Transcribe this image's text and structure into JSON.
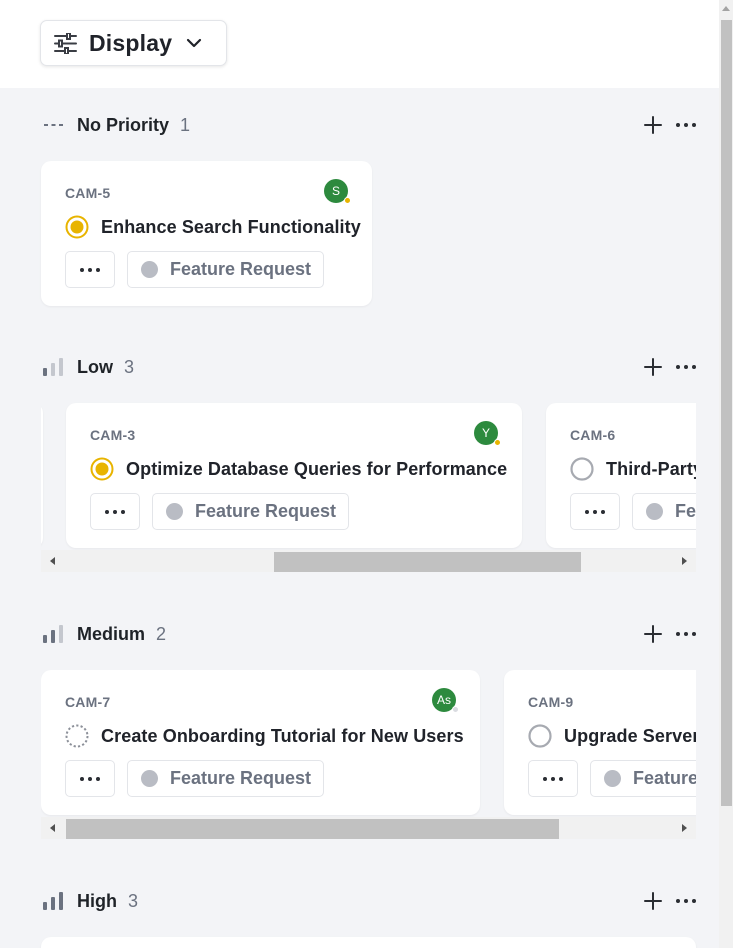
{
  "toolbar": {
    "display_label": "Display"
  },
  "colors": {
    "in_progress": "#e8b400",
    "avatar_bg": "#2d8a3e",
    "label_dot": "#b9bcc4"
  },
  "groups": [
    {
      "name": "No Priority",
      "count": "1",
      "priority_icon": "no-priority-icon",
      "cards": [
        {
          "id": "CAM-5",
          "title": "Enhance Search Functionality",
          "status": "in-progress",
          "assignee": "S",
          "label": "Feature Request"
        }
      ]
    },
    {
      "name": "Low",
      "count": "3",
      "priority_icon": "low-priority-icon",
      "cards": [
        {
          "id": "CAM-3",
          "title": "Optimize Database Queries for Performance",
          "status": "in-progress",
          "assignee": "Y",
          "label": "Feature Request"
        },
        {
          "id": "CAM-6",
          "title": "Third-Party",
          "status": "todo",
          "assignee": "",
          "label": "Fe"
        }
      ]
    },
    {
      "name": "Medium",
      "count": "2",
      "priority_icon": "medium-priority-icon",
      "cards": [
        {
          "id": "CAM-7",
          "title": "Create Onboarding Tutorial for New Users",
          "status": "backlog",
          "assignee": "As",
          "label": "Feature Request"
        },
        {
          "id": "CAM-9",
          "title": "Upgrade Server",
          "status": "todo",
          "assignee": "",
          "label": "Feature"
        }
      ]
    },
    {
      "name": "High",
      "count": "3",
      "priority_icon": "high-priority-icon",
      "cards": []
    }
  ]
}
